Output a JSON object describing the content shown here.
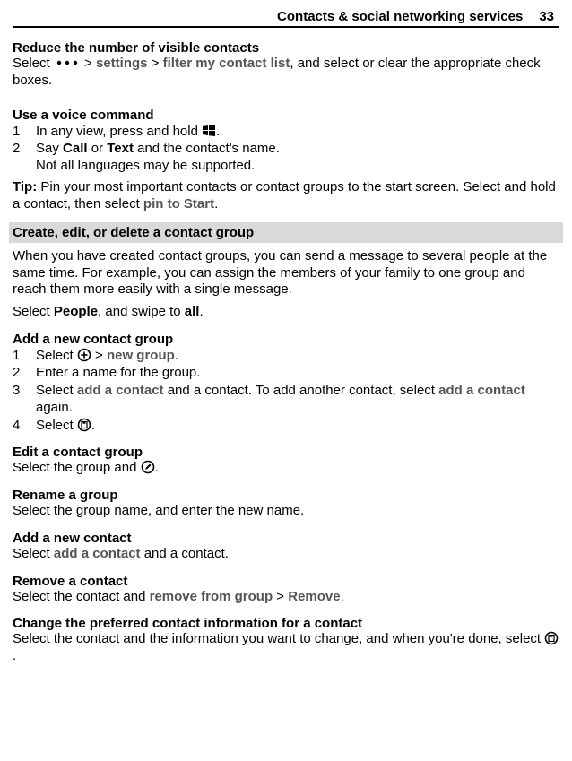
{
  "header": {
    "title": "Contacts & social networking services",
    "page": "33"
  },
  "reduceVisible": {
    "title": "Reduce the number of visible contacts",
    "before": "Select",
    "step_settings": "settings",
    "step_filter": "filter my contact list",
    "after": ", and select or clear the appropriate check boxes."
  },
  "voice": {
    "title": "Use a voice command",
    "step1": "In any view, press and hold ",
    "step2a": "Say ",
    "step2_call": "Call",
    "step2_or": " or ",
    "step2_text": "Text",
    "step2_after": " and the contact's name.",
    "note": "Not all languages may be supported."
  },
  "tip": {
    "label": "Tip:",
    "text_a": " Pin your most important contacts or contact groups to the start screen. Select and hold a contact, then select ",
    "pin": "pin to Start",
    "dot": "."
  },
  "createEditDelete": {
    "band": "Create, edit, or delete a contact group",
    "intro": "When you have created contact groups, you can send a message to several people at the same time. For example, you can assign the members of your family to one group and reach them more easily with a single message.",
    "selectPeople_a": "Select ",
    "people": "People",
    "selectPeople_b": ", and swipe to ",
    "all": "all",
    "selectPeople_c": "."
  },
  "addGroup": {
    "title": "Add a new contact group",
    "step1_a": "Select ",
    "step1_newgroup": "new group",
    "step2": "Enter a name for the group.",
    "step3_a": "Select ",
    "addContact": "add a contact",
    "step3_b": " and a contact. To add another contact, select ",
    "step3_c": " again.",
    "step4": "Select "
  },
  "editGroup": {
    "title": "Edit a contact group",
    "text": "Select the group and "
  },
  "renameGroup": {
    "title": "Rename a group",
    "text": "Select the group name, and enter the new name."
  },
  "addContact": {
    "title": "Add a new contact",
    "a": "Select ",
    "b": "add a contact",
    "c": " and a contact."
  },
  "removeContact": {
    "title": "Remove a contact",
    "a": "Select the contact and ",
    "b": "remove from group",
    "c": "Remove",
    "dot": "."
  },
  "changePref": {
    "title": "Change the preferred contact information for a contact",
    "text": "Select the contact and the information you want to change, and when you're done, select "
  }
}
